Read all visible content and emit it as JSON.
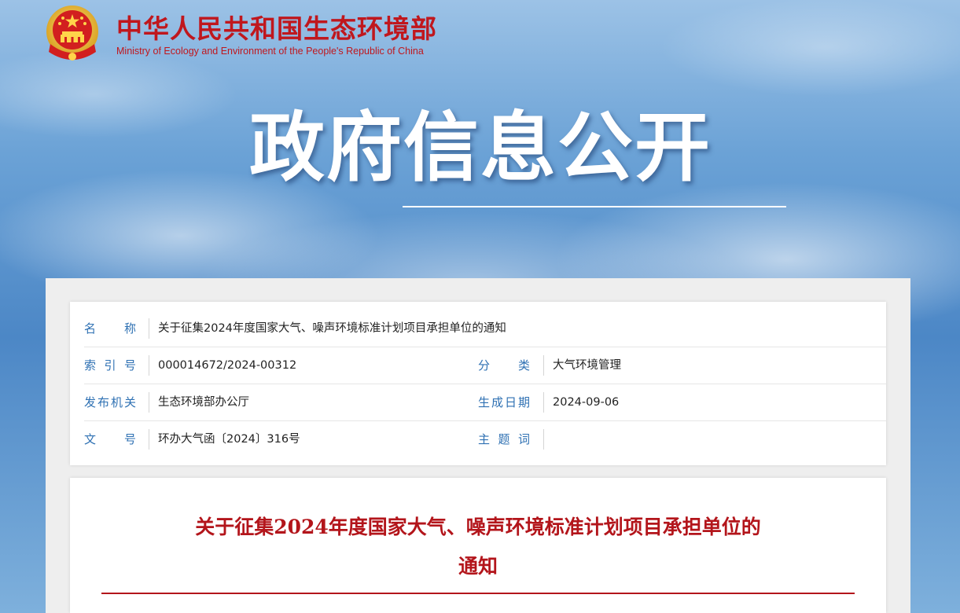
{
  "site": {
    "title_cn": "中华人民共和国生态环境部",
    "title_en": "Ministry of Ecology and Environment of the People's Republic of China",
    "emblem_icon": "national-emblem-icon"
  },
  "banner": {
    "title": "政府信息公开"
  },
  "info": {
    "name_label": "名　称",
    "name_value": "关于征集2024年度国家大气、噪声环境标准计划项目承担单位的通知",
    "index_label": "索引号",
    "index_value": "000014672/2024-00312",
    "category_label": "分　类",
    "category_value": "大气环境管理",
    "issuer_label": "发布机关",
    "issuer_value": "生态环境部办公厅",
    "date_label": "生成日期",
    "date_value": "2024-09-06",
    "doc_no_label": "文　号",
    "doc_no_value": "环办大气函〔2024〕316号",
    "subject_label": "主题词",
    "subject_value": ""
  },
  "document": {
    "title_line1": "关于征集2024年度国家大气、噪声环境标准计划项目承担单位的",
    "title_line2": "通知"
  },
  "colors": {
    "brand_red": "#c0171d",
    "label_blue": "#2f71b3",
    "doc_title_red": "#b3151b"
  }
}
